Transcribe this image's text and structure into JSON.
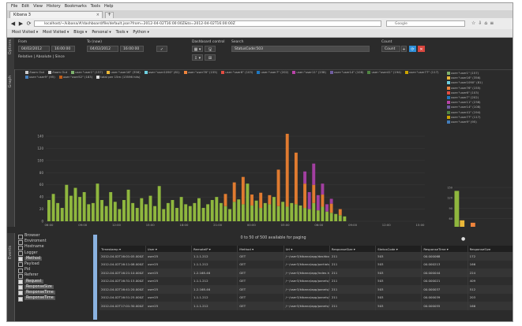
{
  "browser": {
    "menu": [
      "File",
      "Edit",
      "View",
      "History",
      "Bookmarks",
      "Tools",
      "Help"
    ],
    "tab_title": "Kibana 3",
    "tab_close": "×",
    "newtab": "+",
    "url": "localhost/~/kibana/#/dashboard/file/default.json?from=2012-04-02T16:00:00Z&to=2012-04-02T16:00:00Z",
    "search_placeholder": "Google",
    "bookmarks": [
      "Most Visited ▾",
      "Most Visited ▾",
      "Blogs ▾",
      "Personal ▾",
      "Tools ▾",
      "Python ▾"
    ]
  },
  "app": {
    "options_tab": "Options",
    "graph_tab": "Graph",
    "events_tab": "Events",
    "from_label": "From",
    "from_date": "04/02/2012",
    "from_time": "16:00:00",
    "to_label": "To (now)",
    "to_date": "04/02/2012",
    "to_time": "16:00:00",
    "apply_icon": "✓",
    "relative_text": "Relative | Absolute | Since",
    "dashboard_label": "Dashboard control",
    "dash_btn1": "▦ ▾",
    "dash_btn2": "🖫",
    "dash_btn3": "⇩ ▾",
    "dash_btn4": "⊞",
    "search_label": "Search",
    "search_value": "StatusCode:503",
    "count_label": "Count",
    "count_value": "Count",
    "add_icon": "+",
    "refresh_icon": "⟳",
    "remove_icon": "✕"
  },
  "legend_items": [
    {
      "label": "Zoom Out",
      "color": "#cccccc"
    },
    {
      "label": "Zoom Out",
      "color": "#cccccc"
    },
    {
      "label": "user:\"user1\" (157)",
      "color": "#7eb26d"
    },
    {
      "label": "user:\"user16\" (356)",
      "color": "#eab839"
    },
    {
      "label": "user:\"user1090\" (81)",
      "color": "#6ed0e0"
    },
    {
      "label": "user:\"user76\" (155)",
      "color": "#ef843c"
    },
    {
      "label": "user:\"user6\" (103)",
      "color": "#e24d42"
    },
    {
      "label": "user:\"user7\" (202)",
      "color": "#1f78c1"
    },
    {
      "label": "user:\"user11\" (238)",
      "color": "#ba43a9"
    },
    {
      "label": "user:\"user14\" (108)",
      "color": "#705da0"
    },
    {
      "label": "user:\"user41\" (194)",
      "color": "#508642"
    },
    {
      "label": "user:\"user77\" (117)",
      "color": "#cca300"
    },
    {
      "label": "user:\"user9\" (95)",
      "color": "#447ebc"
    },
    {
      "label": "user:\"user52\" (183)",
      "color": "#c15c17"
    },
    {
      "label": "total per 15m (13596 hits)",
      "color": "#dddddd"
    }
  ],
  "right_legend": [
    {
      "label": "user:\"user1\" (157)",
      "color": "#7eb26d"
    },
    {
      "label": "user:\"user16\" (356)",
      "color": "#eab839"
    },
    {
      "label": "user:\"user1090\" (81)",
      "color": "#6ed0e0"
    },
    {
      "label": "user:\"user76\" (155)",
      "color": "#ef843c"
    },
    {
      "label": "user:\"user6\" (103)",
      "color": "#e24d42"
    },
    {
      "label": "user:\"user7\" (202)",
      "color": "#1f78c1"
    },
    {
      "label": "user:\"user11\" (238)",
      "color": "#ba43a9"
    },
    {
      "label": "user:\"user14\" (108)",
      "color": "#705da0"
    },
    {
      "label": "user:\"user41\" (194)",
      "color": "#508642"
    },
    {
      "label": "user:\"user77\" (117)",
      "color": "#cca300"
    },
    {
      "label": "user:\"user9\" (95)",
      "color": "#447ebc"
    }
  ],
  "chart_data": [
    {
      "type": "bar",
      "title": "",
      "xlabel": "",
      "ylabel": "",
      "ylim": [
        0,
        140
      ],
      "yticks": [
        0,
        20,
        40,
        60,
        80,
        100,
        120,
        140
      ],
      "categories": [
        "06:00",
        "09:00",
        "12:00",
        "15:00",
        "18:00",
        "21:00",
        "00:00",
        "03:00",
        "06:00",
        "09:00",
        "12:00",
        "15:00"
      ],
      "x_sublabels": [
        "04/03",
        "04/03",
        "04/03",
        "04/03",
        "04/03",
        "04/03",
        "04/04",
        "04/04",
        "04/04",
        "04/04",
        "04/04",
        "04/04"
      ],
      "series": [
        {
          "name": "user:\"user1\" (157)",
          "color": "#8fb73e",
          "values": [
            35,
            45,
            30,
            22,
            60,
            42,
            55,
            40,
            48,
            28,
            30,
            62,
            35,
            25,
            48,
            32,
            20,
            35,
            52,
            30,
            22,
            38,
            28,
            42,
            25,
            58,
            20,
            30,
            35,
            22,
            40,
            28,
            25,
            30,
            38,
            22,
            28,
            35,
            40,
            30,
            25,
            20,
            32,
            36,
            28,
            62,
            26,
            34,
            22,
            30,
            28,
            40,
            25,
            32,
            24,
            30,
            28,
            26,
            22,
            20,
            30,
            18,
            24,
            16,
            14,
            12,
            10,
            8
          ]
        },
        {
          "name": "user:\"user76\" (155)",
          "color": "#e07b30",
          "values": [
            0,
            0,
            0,
            0,
            0,
            0,
            0,
            0,
            0,
            0,
            0,
            0,
            0,
            0,
            0,
            0,
            0,
            0,
            0,
            0,
            0,
            0,
            0,
            0,
            0,
            0,
            0,
            0,
            0,
            0,
            0,
            0,
            0,
            0,
            0,
            0,
            0,
            0,
            0,
            0,
            20,
            0,
            32,
            0,
            45,
            0,
            18,
            0,
            25,
            0,
            15,
            0,
            60,
            0,
            120,
            0,
            85,
            0,
            40,
            0,
            30,
            0,
            20,
            0,
            15,
            0,
            10,
            0
          ]
        },
        {
          "name": "user:\"user11\" (238)",
          "color": "#a23fa0",
          "values": [
            0,
            0,
            0,
            0,
            0,
            0,
            0,
            0,
            0,
            0,
            0,
            0,
            0,
            0,
            0,
            0,
            0,
            0,
            0,
            0,
            0,
            0,
            0,
            0,
            0,
            0,
            0,
            0,
            0,
            0,
            0,
            0,
            0,
            0,
            0,
            0,
            0,
            0,
            0,
            0,
            0,
            0,
            0,
            0,
            0,
            0,
            0,
            0,
            0,
            0,
            0,
            0,
            0,
            0,
            0,
            0,
            0,
            0,
            20,
            28,
            35,
            25,
            18,
            12,
            8,
            0,
            0,
            0
          ]
        }
      ]
    },
    {
      "type": "bar",
      "title": "",
      "xlabel": "",
      "ylabel": "",
      "ylim": [
        0,
        150
      ],
      "yticks": [
        0,
        30,
        60,
        90,
        120,
        150
      ],
      "categories": [
        "user1",
        "user16",
        "user1090",
        "user76",
        "user6",
        "user7",
        "user11",
        "user14",
        "user41",
        "user77",
        "user9"
      ],
      "values": [
        140,
        55,
        20,
        48,
        30,
        22,
        18,
        20,
        15,
        12,
        10
      ],
      "colors": [
        "#8fb73e",
        "#eab839",
        "#6ed0e0",
        "#ef843c",
        "#e24d42",
        "#1f78c1",
        "#ba43a9",
        "#705da0",
        "#508642",
        "#cca300",
        "#447ebc"
      ]
    }
  ],
  "fields": [
    {
      "label": "Browser",
      "checked": false,
      "hl": false
    },
    {
      "label": "Enviroment",
      "checked": false,
      "hl": false
    },
    {
      "label": "Hostname",
      "checked": false,
      "hl": false
    },
    {
      "label": "Logger",
      "checked": false,
      "hl": false
    },
    {
      "label": "Method",
      "checked": true,
      "hl": true
    },
    {
      "label": "Payload",
      "checked": false,
      "hl": false
    },
    {
      "label": "Pid",
      "checked": false,
      "hl": false
    },
    {
      "label": "Referer",
      "checked": false,
      "hl": false
    },
    {
      "label": "Request",
      "checked": true,
      "hl": true
    },
    {
      "label": "ResponseSize",
      "checked": true,
      "hl": true
    },
    {
      "label": "ResponseTime",
      "checked": true,
      "hl": true
    },
    {
      "label": "ResponseTime",
      "checked": true,
      "hl": true
    }
  ],
  "events": {
    "paging": "0 to 50 of 500 available for paging",
    "pagedot": "●",
    "columns": [
      "Timestamp ▾",
      "User ▾",
      "RemoteIP ▾",
      "Method ▾",
      "Url ▾",
      "ResponseSize ▾",
      "StatusCode ▾",
      "ResponseTime ▾",
      "ResponseSize"
    ],
    "rows": [
      [
        "2012-04-02T16:01:05.000Z",
        "user25",
        "1.1.1.212",
        "GET",
        "/~/user3/kibana/app/dashboards/",
        "211",
        "503",
        "00.000068",
        "172"
      ],
      [
        "2012-04-02T16:11:08.000Z",
        "user25",
        "1.1.1.212",
        "GET",
        "/~/user3/kibana/app/partials/",
        "211",
        "503",
        "00.000213",
        "166"
      ],
      [
        "2012-04-02T16:21:10.000Z",
        "user25",
        "1.2.168.46",
        "GET",
        "/~/user3/kibana/app/index.html?...",
        "211",
        "503",
        "00.000044",
        "224"
      ],
      [
        "2012-04-02T16:31:15.000Z",
        "user25",
        "1.1.1.212",
        "GET",
        "/~/user3/kibana/app/panels/table/module.html",
        "211",
        "503",
        "00.000021",
        "409"
      ],
      [
        "2012-04-02T16:41:20.000Z",
        "user25",
        "1.2.168.46",
        "GET",
        "/~/user3/kibana/app/panels/histogram/module.html",
        "211",
        "503",
        "00.000037",
        "512"
      ],
      [
        "2012-04-02T16:51:25.000Z",
        "user25",
        "1.1.1.212",
        "GET",
        "/~/user3/kibana/app/panels/terms/module.html",
        "211",
        "503",
        "00.000039",
        "203"
      ],
      [
        "2012-04-02T17:01:30.000Z",
        "user25",
        "1.1.1.212",
        "GET",
        "/~/user3/kibana/app/panels/query/module.html",
        "211",
        "503",
        "00.000055",
        "166"
      ]
    ]
  }
}
